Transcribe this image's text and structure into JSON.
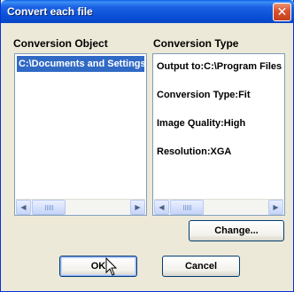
{
  "window": {
    "title": "Convert each file"
  },
  "labels": {
    "conversion_object": "Conversion Object",
    "conversion_type": "Conversion Type"
  },
  "object_list": [
    "C:\\Documents and Settings"
  ],
  "type_list": [
    "Output to:C:\\Program Files",
    "Conversion Type:Fit",
    "Image Quality:High",
    "Resolution:XGA"
  ],
  "buttons": {
    "change": "Change...",
    "ok": "OK",
    "cancel": "Cancel"
  },
  "icons": {
    "close": "close-icon",
    "scroll_left": "chevron-left-icon",
    "scroll_right": "chevron-right-icon",
    "cursor": "mouse-pointer-icon"
  },
  "colors": {
    "selection": "#316ac5",
    "title_bar": "#0a50d6",
    "close": "#d9522e"
  }
}
